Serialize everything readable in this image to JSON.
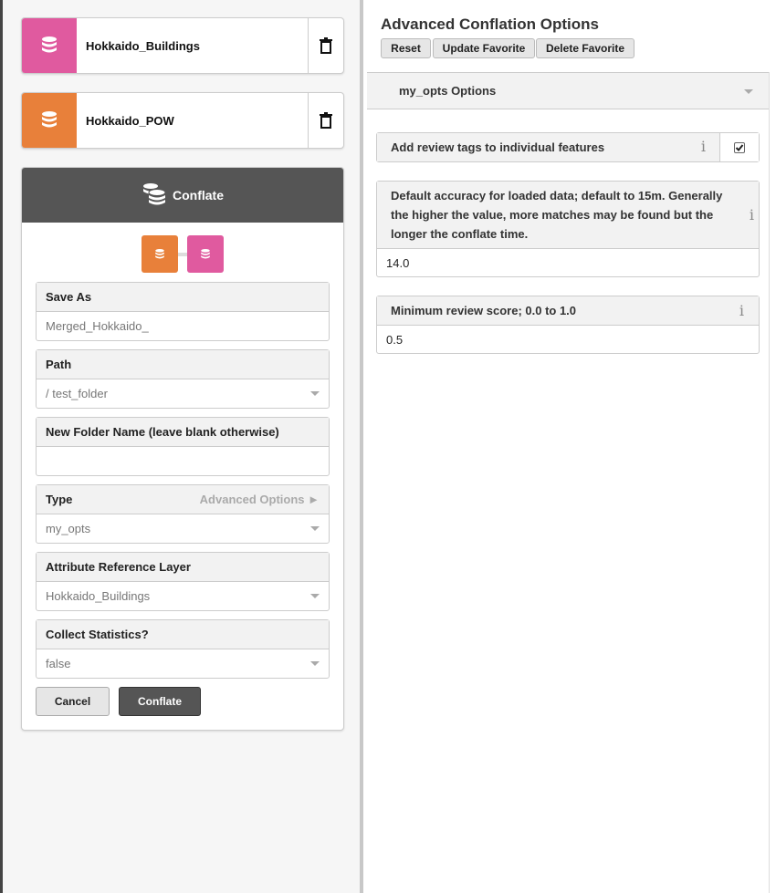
{
  "layers": [
    {
      "name": "Hokkaido_Buildings",
      "color": "#e05a9f"
    },
    {
      "name": "Hokkaido_POW",
      "color": "#e8803a"
    }
  ],
  "conflate_panel": {
    "title": "Conflate",
    "save_as": {
      "label": "Save As",
      "value": "Merged_Hokkaido_"
    },
    "path": {
      "label": "Path",
      "value": "/ test_folder"
    },
    "new_folder": {
      "label": "New Folder Name (leave blank otherwise)",
      "value": ""
    },
    "type": {
      "label": "Type",
      "advanced_link": "Advanced Options ►",
      "value": "my_opts"
    },
    "attribute_ref": {
      "label": "Attribute Reference Layer",
      "value": "Hokkaido_Buildings"
    },
    "collect_stats": {
      "label": "Collect Statistics?",
      "value": "false"
    },
    "cancel_label": "Cancel",
    "conflate_label": "Conflate"
  },
  "advanced": {
    "title": "Advanced Conflation Options",
    "buttons": {
      "reset": "Reset",
      "update_favorite": "Update Favorite",
      "delete_favorite": "Delete Favorite"
    },
    "options_header": "my_opts Options",
    "options": [
      {
        "label": "Add review tags to individual features",
        "checked": true
      },
      {
        "label": "Default accuracy for loaded data; default to 15m. Generally the higher the value, more matches may be found but the longer the conflate time.",
        "value": "14.0"
      },
      {
        "label": "Minimum review score; 0.0 to 1.0",
        "value": "0.5"
      }
    ],
    "info_glyph": "i"
  },
  "colors": {
    "pink": "#e05a9f",
    "orange": "#e8803a",
    "header_dark": "#555555"
  }
}
